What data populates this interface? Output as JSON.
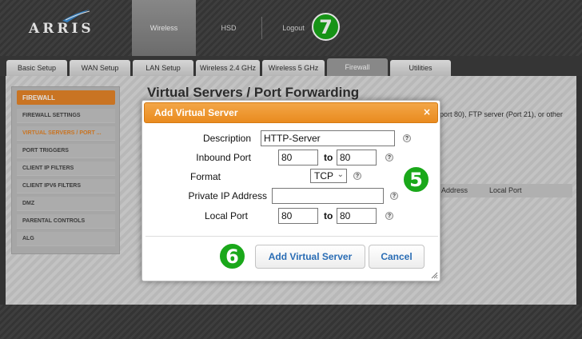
{
  "header": {
    "logo_text": "ARRIS",
    "nav": [
      {
        "label": "Wireless",
        "active": true
      },
      {
        "label": "HSD",
        "active": false
      },
      {
        "label": "Logout",
        "active": false
      }
    ],
    "step_badge": "7"
  },
  "tabs": [
    {
      "label": "Basic Setup"
    },
    {
      "label": "WAN Setup"
    },
    {
      "label": "LAN Setup"
    },
    {
      "label": "Wireless 2.4 GHz"
    },
    {
      "label": "Wireless 5 GHz"
    },
    {
      "label": "Firewall",
      "active": true
    },
    {
      "label": "Utilities"
    }
  ],
  "sidebar": {
    "heading": "FIREWALL",
    "items": [
      {
        "label": "FIREWALL SETTINGS"
      },
      {
        "label": "VIRTUAL SERVERS / PORT ...",
        "active": true
      },
      {
        "label": "PORT TRIGGERS"
      },
      {
        "label": "CLIENT IP FILTERS"
      },
      {
        "label": "CLIENT IPV6 FILTERS"
      },
      {
        "label": "DMZ"
      },
      {
        "label": "PARENTAL CONTROLS"
      },
      {
        "label": "ALG"
      }
    ]
  },
  "page": {
    "title": "Virtual Servers / Port Forwarding",
    "desc_fragment": "port 80), FTP server (Port 21), or other",
    "table_headers": [
      "Address",
      "Local Port"
    ]
  },
  "dialog": {
    "title": "Add Virtual Server",
    "close_glyph": "×",
    "fields": {
      "description_label": "Description",
      "description_value": "HTTP-Server",
      "inbound_port_label": "Inbound Port",
      "inbound_from": "80",
      "inbound_to": "80",
      "format_label": "Format",
      "format_value": "TCP",
      "private_ip_label": "Private IP Address",
      "private_ip_value": "",
      "local_port_label": "Local Port",
      "local_from": "80",
      "local_to": "80",
      "to_word": "to",
      "help_glyph": "?"
    },
    "add_button": "Add Virtual Server",
    "cancel_button": "Cancel",
    "step_badge_form": "5",
    "step_badge_button": "6"
  },
  "colors": {
    "accent_orange": "#e98b1f",
    "badge_green": "#1aa81a",
    "button_text_blue": "#2a6db5"
  }
}
